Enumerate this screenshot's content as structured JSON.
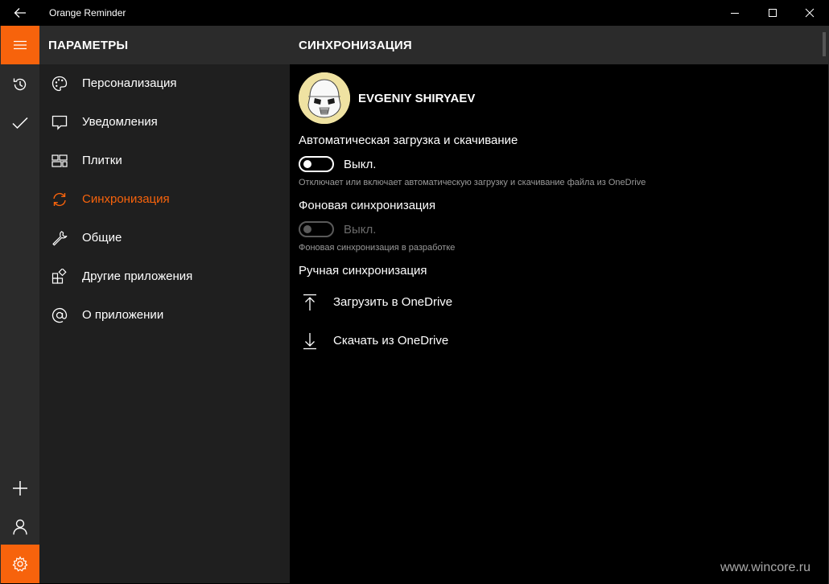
{
  "window": {
    "title": "Orange Reminder",
    "accent_color": "#f7630c"
  },
  "rail": {
    "top_items": [
      {
        "icon": "hamburger-menu-icon"
      },
      {
        "icon": "history-icon"
      },
      {
        "icon": "checkmark-icon"
      }
    ],
    "bottom_items": [
      {
        "icon": "plus-icon"
      },
      {
        "icon": "person-icon"
      },
      {
        "icon": "gear-icon"
      }
    ]
  },
  "settings_pane": {
    "header": "ПАРАМЕТРЫ",
    "items": [
      {
        "label": "Персонализация",
        "icon": "palette-icon"
      },
      {
        "label": "Уведомления",
        "icon": "notification-icon"
      },
      {
        "label": "Плитки",
        "icon": "tiles-icon"
      },
      {
        "label": "Синхронизация",
        "icon": "sync-icon",
        "active": true
      },
      {
        "label": "Общие",
        "icon": "wrench-icon"
      },
      {
        "label": "Другие приложения",
        "icon": "apps-icon"
      },
      {
        "label": "О приложении",
        "icon": "at-icon"
      }
    ]
  },
  "content": {
    "header": "СИНХРОНИЗАЦИЯ",
    "user_name": "EVGENIY SHIRYAEV",
    "auto_sync": {
      "title": "Автоматическая загрузка и скачивание",
      "toggle_label": "Выкл.",
      "enabled": false,
      "hint": "Отключает или включает автоматическую загрузку и скачивание файла из OneDrive"
    },
    "background_sync": {
      "title": "Фоновая синхронизация",
      "toggle_label": "Выкл.",
      "enabled": false,
      "disabled": true,
      "hint": "Фоновая синхронизация в разработке"
    },
    "manual_sync": {
      "title": "Ручная синхронизация",
      "upload_label": "Загрузить в OneDrive",
      "download_label": "Скачать из OneDrive"
    }
  },
  "watermark": "www.wincore.ru"
}
